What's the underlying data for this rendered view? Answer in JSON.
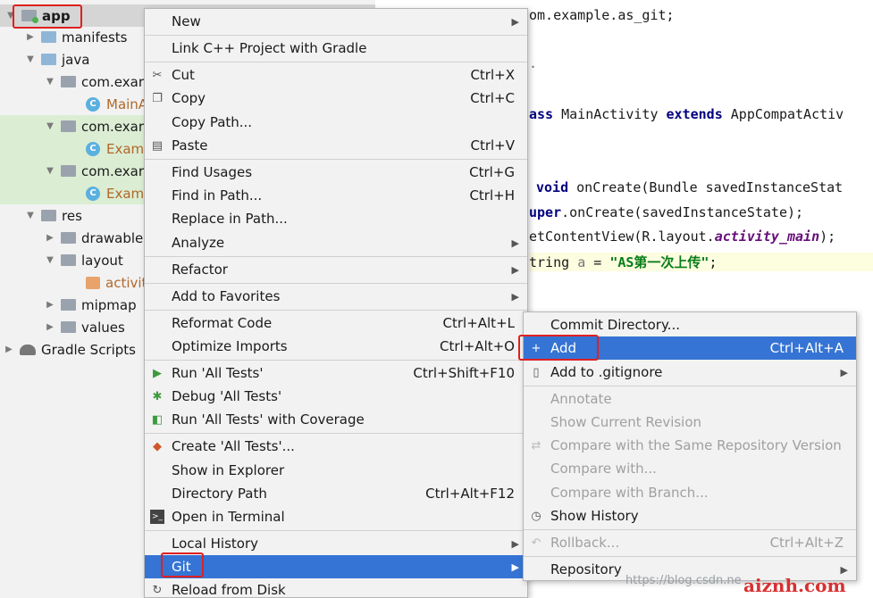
{
  "tree": [
    {
      "label": "app",
      "icon": "module-folder-icon",
      "bold": true,
      "selected": true
    },
    {
      "label": "manifests",
      "icon": "folder-icon"
    },
    {
      "label": "java",
      "icon": "folder-icon"
    },
    {
      "label": "com.exar",
      "icon": "package-icon"
    },
    {
      "label": "MainA",
      "icon": "class-icon"
    },
    {
      "label": "com.exar",
      "icon": "package-icon"
    },
    {
      "label": "Examp",
      "icon": "class-icon"
    },
    {
      "label": "com.exar",
      "icon": "package-icon"
    },
    {
      "label": "Examp",
      "icon": "class-icon"
    },
    {
      "label": "res",
      "icon": "folder-icon"
    },
    {
      "label": "drawable",
      "icon": "folder-icon"
    },
    {
      "label": "layout",
      "icon": "folder-icon"
    },
    {
      "label": "activit",
      "icon": "xml-file-icon"
    },
    {
      "label": "mipmap",
      "icon": "folder-icon"
    },
    {
      "label": "values",
      "icon": "folder-icon"
    },
    {
      "label": "Gradle Scripts",
      "icon": "gradle-icon"
    }
  ],
  "editor": {
    "line1": "om.example.as_git;",
    "line2": ".",
    "line3_kw1": "ass",
    "line3_mid": " MainActivity ",
    "line3_kw2": "extends",
    "line3_end": " AppCompatActiv",
    "line4_kw": "void",
    "line4_end": " onCreate(Bundle savedInstanceStat",
    "line5_kw": "uper",
    "line5_end": ".onCreate(savedInstanceState);",
    "line6_a": "etContentView(R.layout.",
    "line6_field": "activity_main",
    "line6_b": ");",
    "line7_a": "tring ",
    "line7_var": "a",
    "line7_b": " = ",
    "line7_str": "\"AS第一次上传\"",
    "line7_c": ";"
  },
  "menu": {
    "new": "New",
    "link_cpp": "Link C++ Project with Gradle",
    "cut": "Cut",
    "cut_sc": "Ctrl+X",
    "copy": "Copy",
    "copy_sc": "Ctrl+C",
    "copy_path": "Copy Path...",
    "paste": "Paste",
    "paste_sc": "Ctrl+V",
    "find_usages": "Find Usages",
    "find_usages_sc": "Ctrl+G",
    "find_in_path": "Find in Path...",
    "find_in_path_sc": "Ctrl+H",
    "replace_in_path": "Replace in Path...",
    "analyze": "Analyze",
    "refactor": "Refactor",
    "add_to_favorites": "Add to Favorites",
    "reformat_code": "Reformat Code",
    "reformat_code_sc": "Ctrl+Alt+L",
    "optimize_imports": "Optimize Imports",
    "optimize_imports_sc": "Ctrl+Alt+O",
    "run_all_tests": "Run 'All Tests'",
    "run_all_tests_sc": "Ctrl+Shift+F10",
    "debug_all_tests": "Debug 'All Tests'",
    "run_coverage": "Run 'All Tests' with Coverage",
    "create_all_tests": "Create 'All Tests'...",
    "show_in_explorer": "Show in Explorer",
    "directory_path": "Directory Path",
    "directory_path_sc": "Ctrl+Alt+F12",
    "open_in_terminal": "Open in Terminal",
    "local_history": "Local History",
    "git": "Git",
    "reload_from_disk": "Reload from Disk"
  },
  "git_menu": {
    "commit_directory": "Commit Directory...",
    "add": "Add",
    "add_sc": "Ctrl+Alt+A",
    "add_to_gitignore": "Add to .gitignore",
    "annotate": "Annotate",
    "show_current_revision": "Show Current Revision",
    "compare_same_repo": "Compare with the Same Repository Version",
    "compare_with": "Compare with...",
    "compare_with_branch": "Compare with Branch...",
    "show_history": "Show History",
    "rollback": "Rollback...",
    "rollback_sc": "Ctrl+Alt+Z",
    "repository": "Repository"
  },
  "watermark": {
    "url": "https://blog.csdn.ne",
    "brand": "aiznh.com"
  },
  "colors": {
    "menu_bg": "#f2f2f2",
    "selection": "#3574d4",
    "highlight_box": "#e02020"
  }
}
